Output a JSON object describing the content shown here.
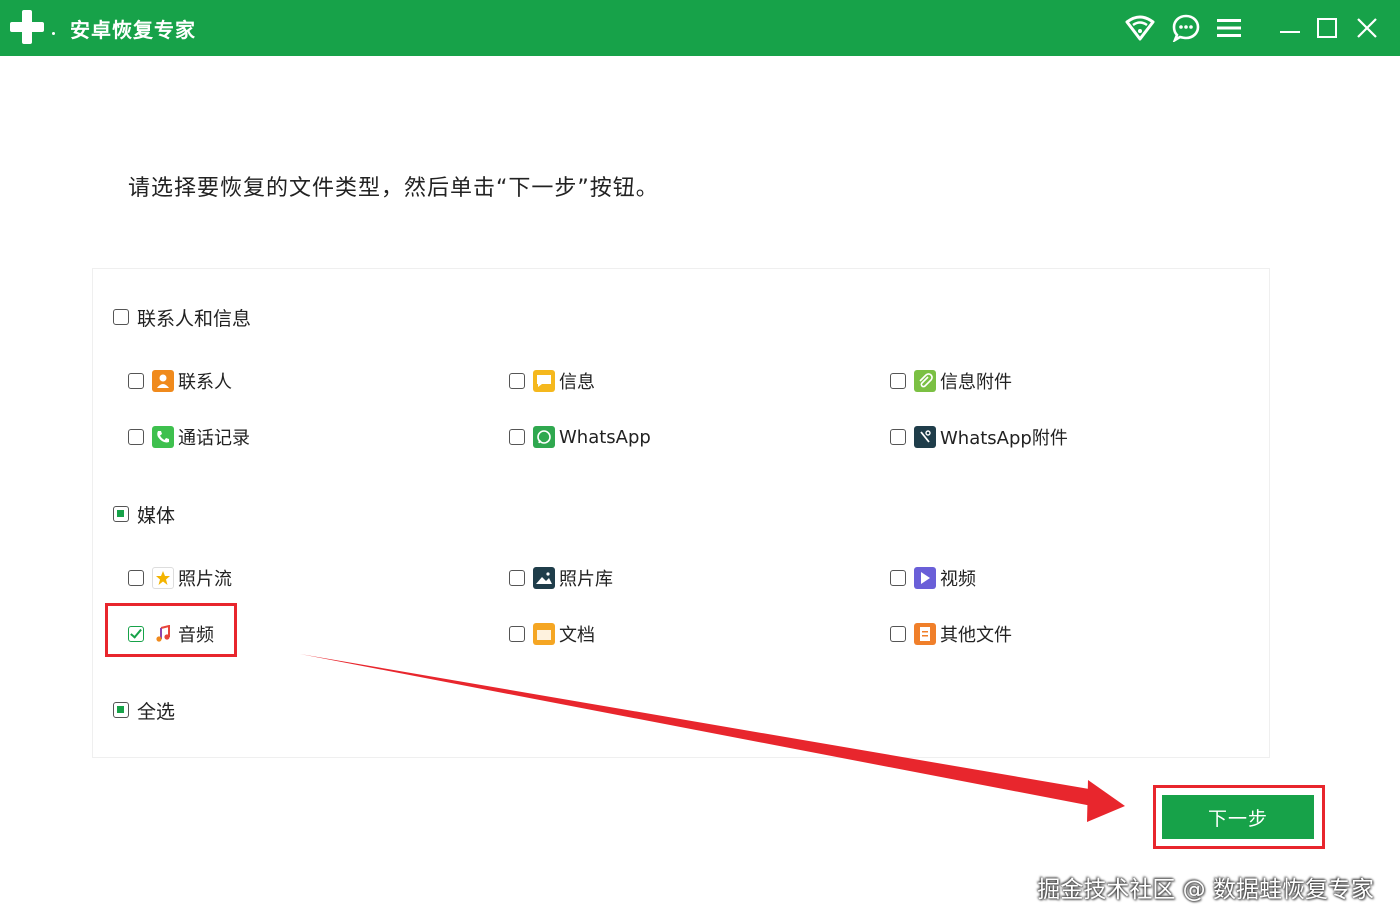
{
  "app": {
    "title": "安卓恢复专家"
  },
  "titlebar": {
    "icons": [
      "wifi-icon",
      "feedback-icon",
      "menu-icon",
      "minimize-icon",
      "maximize-icon",
      "close-icon"
    ]
  },
  "instruction": "请选择要恢复的文件类型，然后单击“下一步”按钮。",
  "groups": {
    "contacts": {
      "label": "联系人和信息",
      "state": "unchecked",
      "items": [
        {
          "label": "联系人",
          "icon": "contacts-icon",
          "checked": false
        },
        {
          "label": "信息",
          "icon": "message-icon",
          "checked": false
        },
        {
          "label": "信息附件",
          "icon": "attachment-icon",
          "checked": false
        },
        {
          "label": "通话记录",
          "icon": "phone-icon",
          "checked": false
        },
        {
          "label": "WhatsApp",
          "icon": "whatsapp-icon",
          "checked": false
        },
        {
          "label": "WhatsApp附件",
          "icon": "whatsapp-attachment-icon",
          "checked": false
        }
      ]
    },
    "media": {
      "label": "媒体",
      "state": "partial",
      "items": [
        {
          "label": "照片流",
          "icon": "photostream-icon",
          "checked": false
        },
        {
          "label": "照片库",
          "icon": "photo-library-icon",
          "checked": false
        },
        {
          "label": "视频",
          "icon": "video-icon",
          "checked": false
        },
        {
          "label": "音频",
          "icon": "audio-icon",
          "checked": true
        },
        {
          "label": "文档",
          "icon": "folder-icon",
          "checked": false
        },
        {
          "label": "其他文件",
          "icon": "other-files-icon",
          "checked": false
        }
      ]
    },
    "select_all": {
      "label": "全选",
      "state": "partial"
    }
  },
  "next_button": {
    "label": "下一步"
  },
  "watermark": "掘金技术社区 @ 数据蛙恢复专家",
  "colors": {
    "brand": "#17a249",
    "annotation": "#e8262d"
  }
}
